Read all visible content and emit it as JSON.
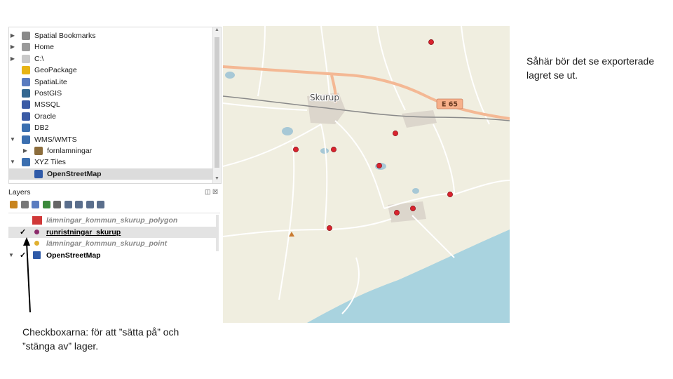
{
  "browser": {
    "items": [
      {
        "label": "Spatial Bookmarks",
        "expander": "▶",
        "icon": "bookmark-icon",
        "color": "#8a8a8a",
        "indent": 0
      },
      {
        "label": "Home",
        "expander": "▶",
        "icon": "home-icon",
        "color": "#9a9a9a",
        "indent": 0
      },
      {
        "label": "C:\\",
        "expander": "▶",
        "icon": "folder-icon",
        "color": "#c9c9c9",
        "indent": 0
      },
      {
        "label": "GeoPackage",
        "expander": "",
        "icon": "geopackage-icon",
        "color": "#e7b416",
        "indent": 0
      },
      {
        "label": "SpatiaLite",
        "expander": "",
        "icon": "spatialite-icon",
        "color": "#5a7cc0",
        "indent": 0
      },
      {
        "label": "PostGIS",
        "expander": "",
        "icon": "postgis-icon",
        "color": "#336791",
        "indent": 0
      },
      {
        "label": "MSSQL",
        "expander": "",
        "icon": "mssql-icon",
        "color": "#3b5ba5",
        "indent": 0
      },
      {
        "label": "Oracle",
        "expander": "",
        "icon": "oracle-icon",
        "color": "#3b5ba5",
        "indent": 0
      },
      {
        "label": "DB2",
        "expander": "",
        "icon": "db2-icon",
        "color": "#3b6fb0",
        "indent": 0
      },
      {
        "label": "WMS/WMTS",
        "expander": "▼",
        "icon": "globe-icon",
        "color": "#3b6fb0",
        "indent": 0
      },
      {
        "label": "fornlamningar",
        "expander": "▶",
        "icon": "wms-layer-icon",
        "color": "#8c6d3c",
        "indent": 1
      },
      {
        "label": "XYZ Tiles",
        "expander": "▼",
        "icon": "xyz-tiles-icon",
        "color": "#3b6fb0",
        "indent": 0
      },
      {
        "label": "OpenStreetMap",
        "expander": "",
        "icon": "osm-icon",
        "color": "#2f5aa8",
        "indent": 1,
        "selected": true
      }
    ]
  },
  "layers": {
    "title": "Layers",
    "controls": "◫ ☒",
    "toolbar_icons": [
      {
        "name": "style-manager-icon",
        "color": "#c8841e"
      },
      {
        "name": "add-group-icon",
        "color": "#777777"
      },
      {
        "name": "filter-legend-icon",
        "color": "#5a7cc0"
      },
      {
        "name": "filter-expression-icon",
        "color": "#3b8a3b"
      },
      {
        "name": "expression-icon",
        "color": "#666666"
      },
      {
        "name": "expand-all-icon",
        "color": "#5a6e8c"
      },
      {
        "name": "collapse-all-icon",
        "color": "#5a6e8c"
      },
      {
        "name": "remove-layer-icon",
        "color": "#5a6e8c"
      },
      {
        "name": "open-attribute-table-icon",
        "color": "#5a6e8c"
      }
    ],
    "items": [
      {
        "name": "lämningar_kommun_skurup_polygon",
        "checked": "",
        "symbol": "square",
        "color": "#d03838",
        "style": "italic-grey"
      },
      {
        "name": "runristningar_skurup",
        "checked": "✓",
        "symbol": "circle",
        "color": "#8b2a6b",
        "style": "bold-underline",
        "selected": true
      },
      {
        "name": "lämningar_kommun_skurup_point",
        "checked": "",
        "symbol": "circle",
        "color": "#e0b030",
        "style": "italic-grey"
      },
      {
        "name": "OpenStreetMap",
        "checked": "✓",
        "symbol": "osm",
        "color": "#2f5aa8",
        "style": "bold",
        "expander": "▼"
      }
    ]
  },
  "map": {
    "town_label": "Skurup",
    "road_shield": "E 65",
    "colors": {
      "land": "#f0eee0",
      "sea": "#a9d3df",
      "road_major": "#f4b894",
      "road_minor": "#ffffff",
      "rail": "#8a8a8a",
      "town": "#dcd6cc",
      "water": "#a7c8d6",
      "marker": "#d9232e",
      "triangle": "#c97a30"
    },
    "markers": 12
  },
  "side_note": "Såhär bör det se exporterade lagret se ut.",
  "caption": "Checkboxarna: för att ”sätta på” och ”stänga av” lager."
}
